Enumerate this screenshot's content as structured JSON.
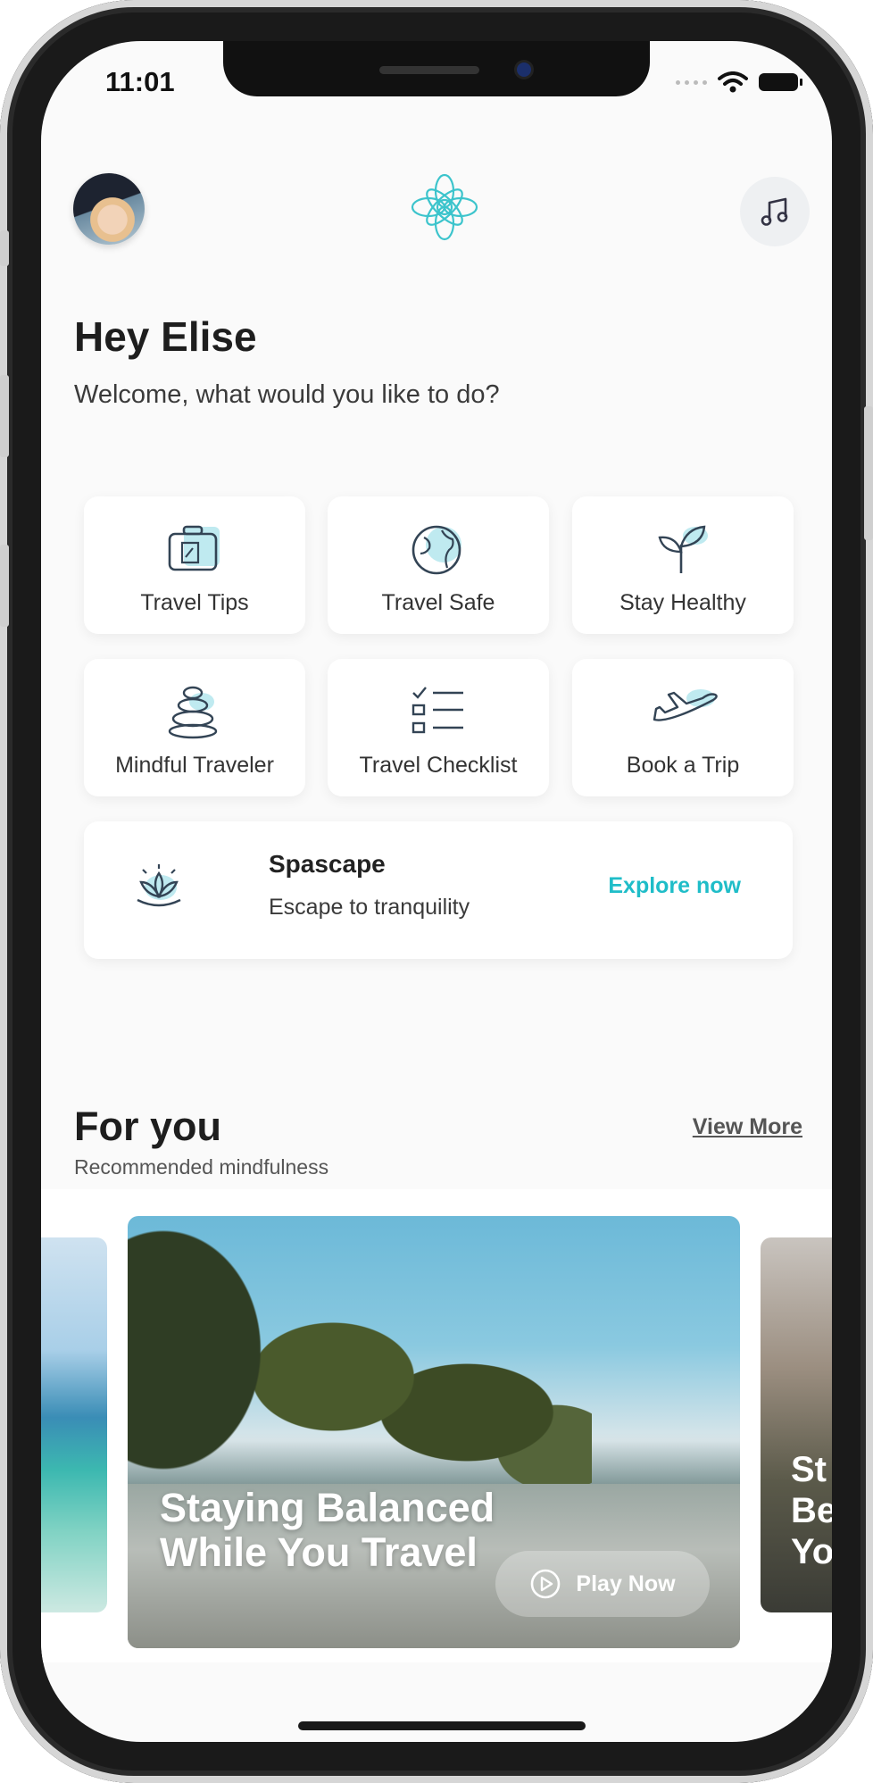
{
  "status_bar": {
    "time": "11:01"
  },
  "header": {
    "avatar_icon": "user-avatar",
    "logo_icon": "mandala-logo",
    "music_icon": "music-note-icon",
    "accent_color": "#1fbdc8"
  },
  "greeting": {
    "title": "Hey Elise",
    "subtitle": "Welcome, what would you like to do?"
  },
  "tiles": [
    {
      "label": "Travel Tips",
      "icon": "suitcase-icon"
    },
    {
      "label": "Travel Safe",
      "icon": "globe-icon"
    },
    {
      "label": "Stay Healthy",
      "icon": "sprout-icon"
    },
    {
      "label": "Mindful Traveler",
      "icon": "stacked-stones-icon"
    },
    {
      "label": "Travel Checklist",
      "icon": "checklist-icon"
    },
    {
      "label": "Book a Trip",
      "icon": "airplane-icon"
    }
  ],
  "spa_card": {
    "title": "Spascape",
    "subtitle": "Escape to tranquility",
    "cta": "Explore now",
    "icon": "lotus-icon"
  },
  "for_you": {
    "title": "For you",
    "subtitle": "Recommended mindfulness",
    "view_more": "View More"
  },
  "carousel": {
    "main_card": {
      "title": "Staying Balanced While You Travel",
      "cta": "Play Now"
    },
    "next_card_partial": "St\nBe\nYo"
  }
}
